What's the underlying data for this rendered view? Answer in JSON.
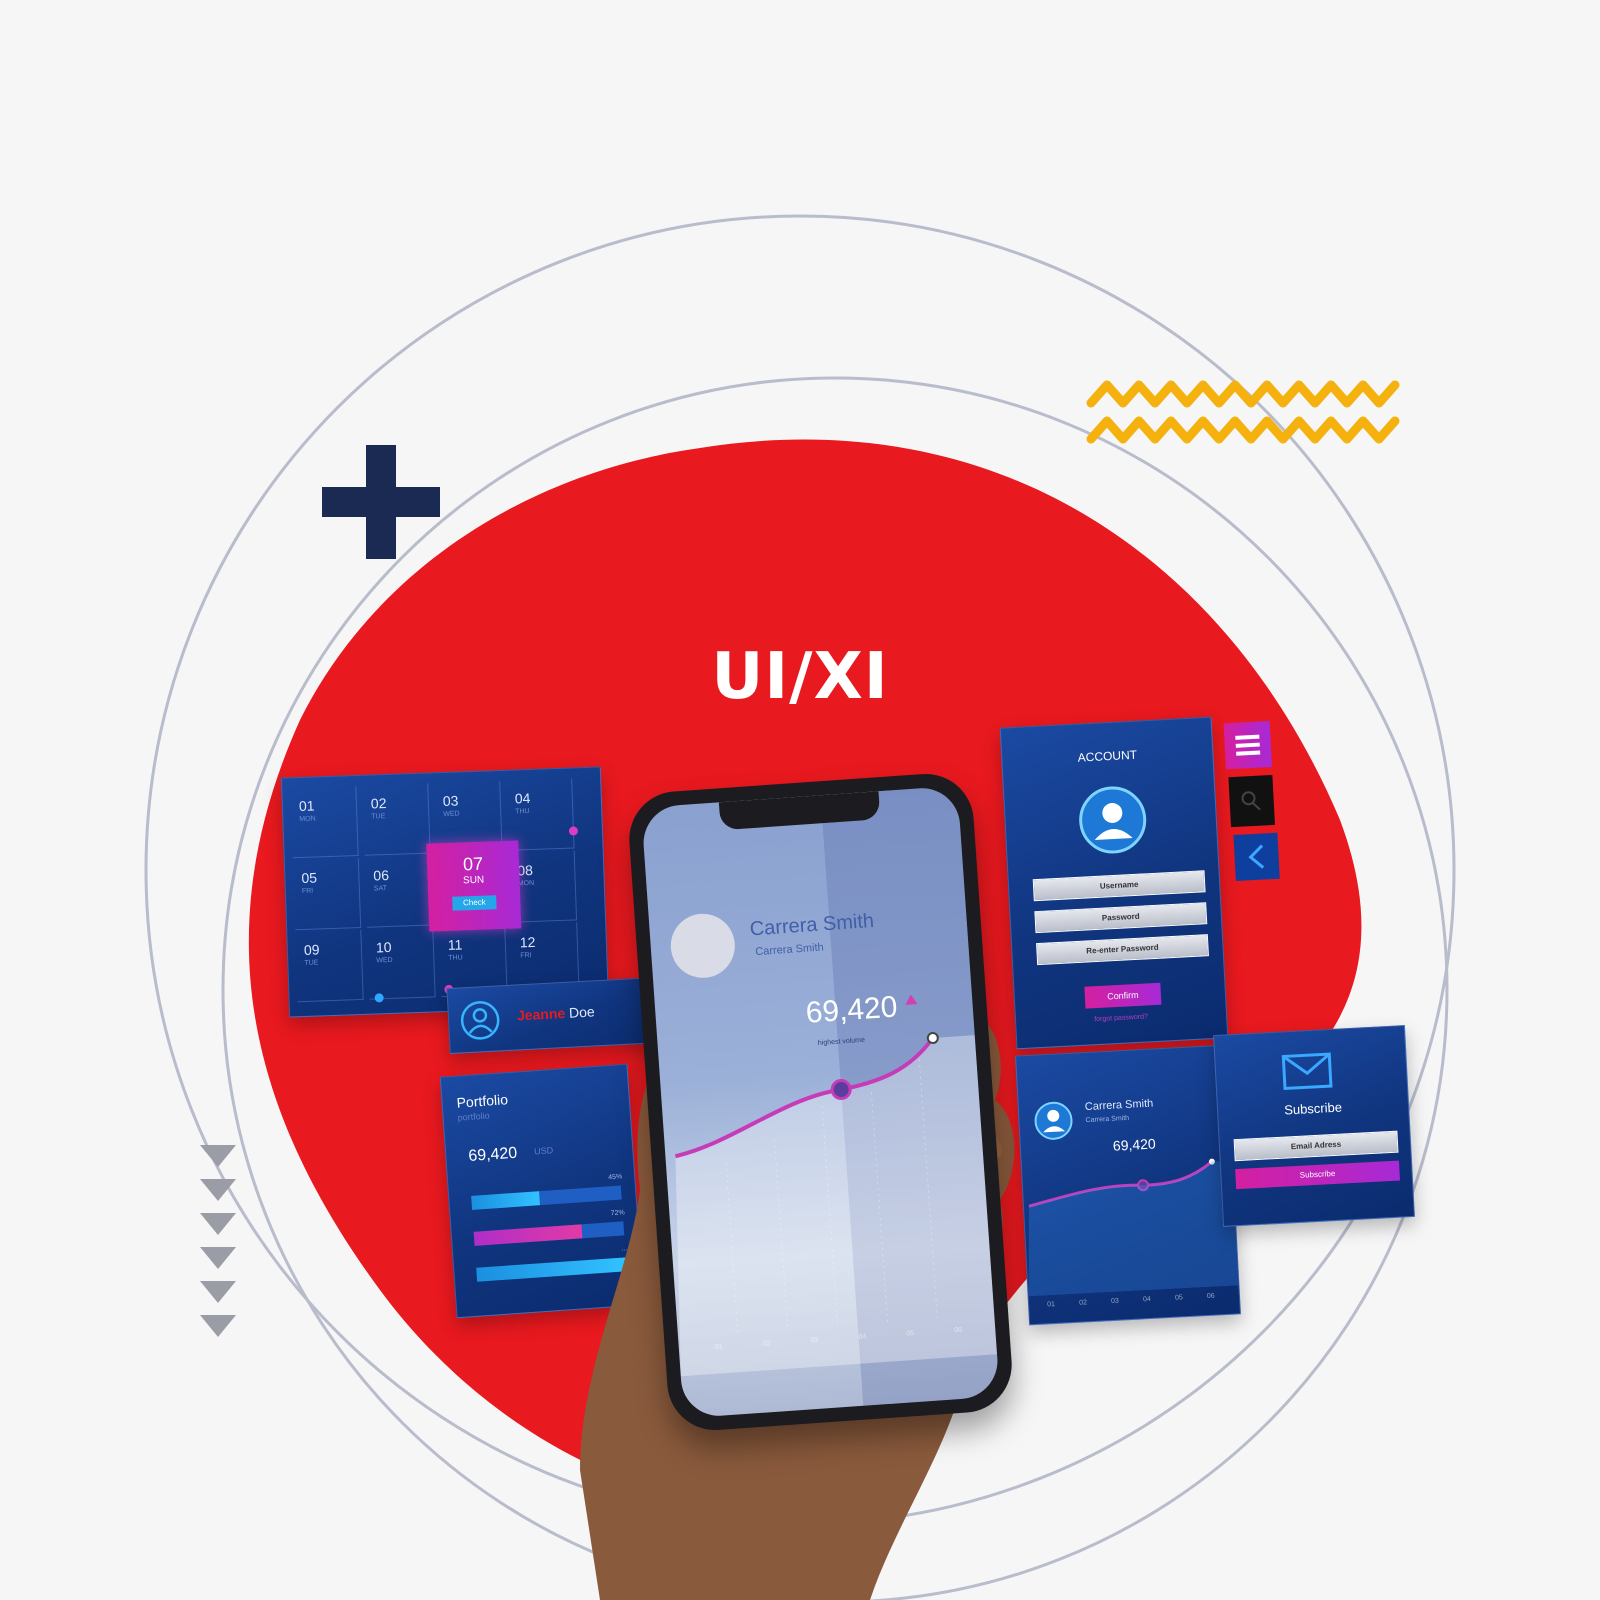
{
  "title": "UI/XI",
  "colors": {
    "red": "#e8191f",
    "navy": "#1a2a52",
    "yellow": "#f5b20e",
    "gray": "#9a9da6",
    "ring": "#b8bccb"
  },
  "calendar": {
    "days": [
      {
        "num": "01",
        "day": "MON"
      },
      {
        "num": "02",
        "day": "TUE"
      },
      {
        "num": "03",
        "day": "WED"
      },
      {
        "num": "04",
        "day": "THU"
      },
      {
        "num": "05",
        "day": "FRI"
      },
      {
        "num": "06",
        "day": "SAT"
      },
      {
        "num": "07",
        "day": "SUN"
      },
      {
        "num": "08",
        "day": "MON"
      },
      {
        "num": "09",
        "day": "TUE"
      },
      {
        "num": "10",
        "day": "WED"
      },
      {
        "num": "11",
        "day": "THU"
      },
      {
        "num": "12",
        "day": "FRI"
      }
    ],
    "selected_num": "07",
    "selected_day": "SUN",
    "check_label": "Check"
  },
  "profile_strip": {
    "first": "Jeanne",
    "last": "Doe"
  },
  "portfolio": {
    "title": "Portfolio",
    "subtitle": "portfolio",
    "value": "69,420",
    "currency": "USD",
    "bars": [
      {
        "label": "45%",
        "fill": 0.45
      },
      {
        "label": "72%",
        "fill": 0.72
      },
      {
        "label": "...",
        "fill": 0.0
      }
    ]
  },
  "phone": {
    "name": "Carrera Smith",
    "subname": "Carrera Smith",
    "value": "69,420",
    "caption": "highest volume",
    "x_ticks": [
      "01",
      "02",
      "03",
      "04",
      "05",
      "06"
    ]
  },
  "account": {
    "title": "ACCOUNT",
    "username": "Username",
    "password": "Password",
    "reenter": "Re-enter Password",
    "confirm": "Confirm",
    "forgot": "forgot password?"
  },
  "stats_card": {
    "name": "Carrera Smith",
    "subname": "Carrera Smith",
    "value": "69,420",
    "x_ticks": [
      "01",
      "02",
      "03",
      "04",
      "05",
      "06"
    ]
  },
  "subscribe": {
    "title": "Subscribe",
    "email_placeholder": "Email Adress",
    "button": "Subscribe"
  }
}
